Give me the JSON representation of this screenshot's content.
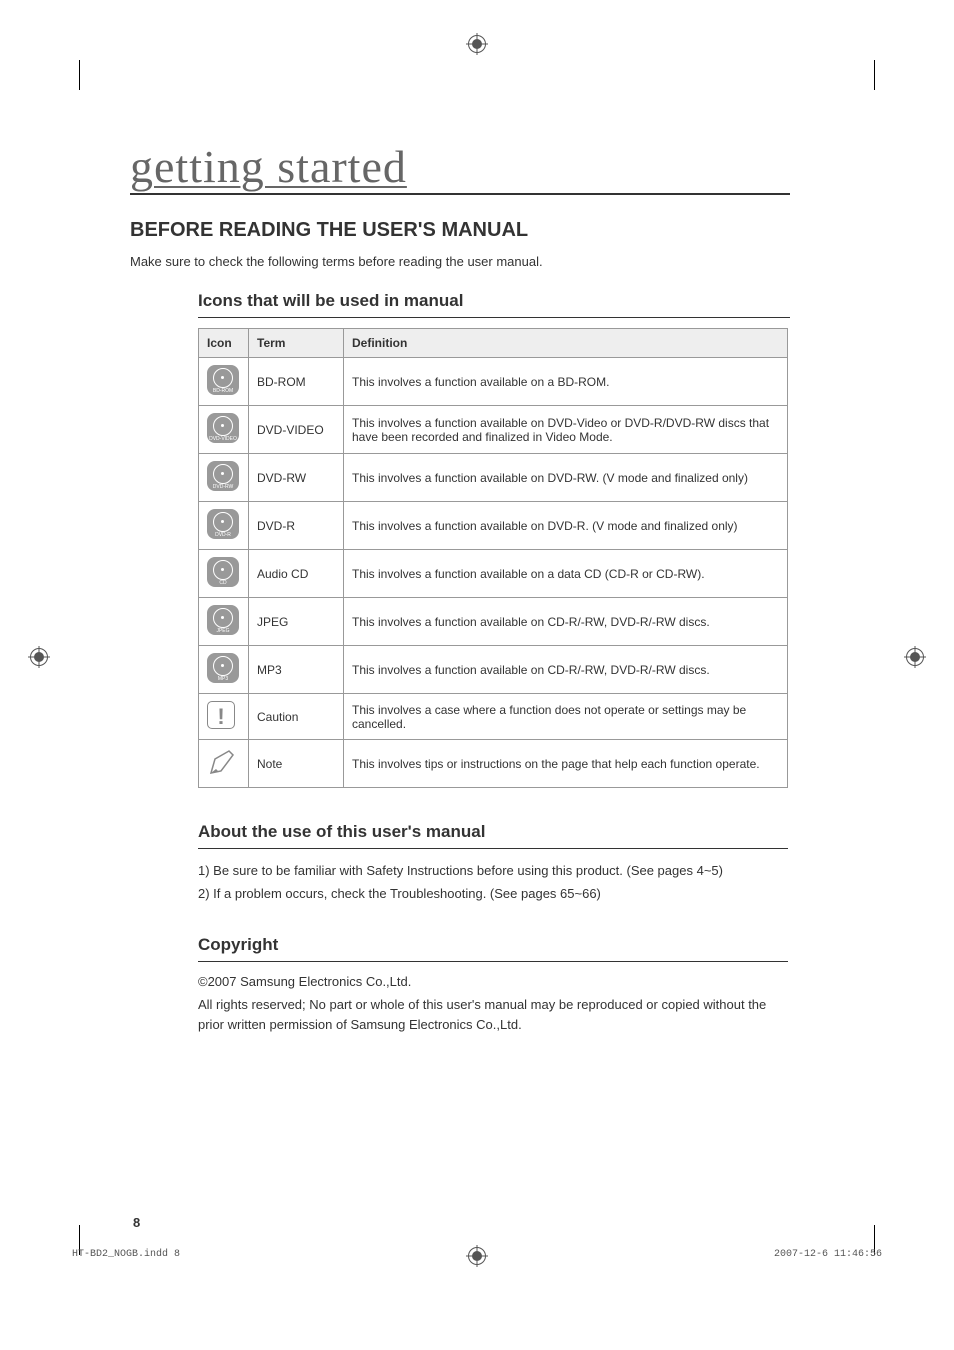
{
  "page_title": "getting started",
  "section_heading": "BEFORE READING THE USER'S MANUAL",
  "lead_text": "Make sure to check the following terms before reading the user manual.",
  "icons_heading": "Icons that will be used in manual",
  "table": {
    "headers": {
      "icon": "Icon",
      "term": "Term",
      "definition": "Definition"
    },
    "rows": [
      {
        "icon_label": "BD-ROM",
        "term": "BD-ROM",
        "definition": "This involves a function available on a BD-ROM."
      },
      {
        "icon_label": "DVD-VIDEO",
        "term": "DVD-VIDEO",
        "definition": "This involves a function available on DVD-Video or DVD-R/DVD-RW discs that have been recorded and finalized in Video Mode."
      },
      {
        "icon_label": "DVD-RW",
        "term": "DVD-RW",
        "definition": "This involves a function available on DVD-RW. (V mode and finalized only)"
      },
      {
        "icon_label": "DVD-R",
        "term": "DVD-R",
        "definition": "This involves a function available on DVD-R. (V mode and finalized only)"
      },
      {
        "icon_label": "CD",
        "term": "Audio CD",
        "definition": "This involves a function available on a data CD (CD-R or CD-RW)."
      },
      {
        "icon_label": "JPEG",
        "term": "JPEG",
        "definition": "This involves a function available on CD-R/-RW, DVD-R/-RW discs."
      },
      {
        "icon_label": "MP3",
        "term": "MP3",
        "definition": "This involves a function available on CD-R/-RW, DVD-R/-RW discs."
      },
      {
        "icon_label": "",
        "term": "Caution",
        "definition": "This involves a case where a function does not operate or settings may be cancelled."
      },
      {
        "icon_label": "",
        "term": "Note",
        "definition": "This involves tips or instructions on the page that help each function operate."
      }
    ]
  },
  "about_heading": "About the use of this user's manual",
  "about_items": [
    "1)  Be sure to be familiar with Safety Instructions before using this product. (See pages 4~5)",
    "2)  If a problem occurs, check the Troubleshooting. (See pages 65~66)"
  ],
  "copyright_heading": "Copyright",
  "copyright_line1": "©2007 Samsung Electronics Co.,Ltd.",
  "copyright_line2": "All rights reserved; No part or whole of this user's manual may be reproduced or copied without the prior written permission of Samsung Electronics Co.,Ltd.",
  "page_number": "8",
  "footer_left": "HT-BD2_NOGB.indd   8",
  "footer_right": "2007-12-6   11:46:56"
}
